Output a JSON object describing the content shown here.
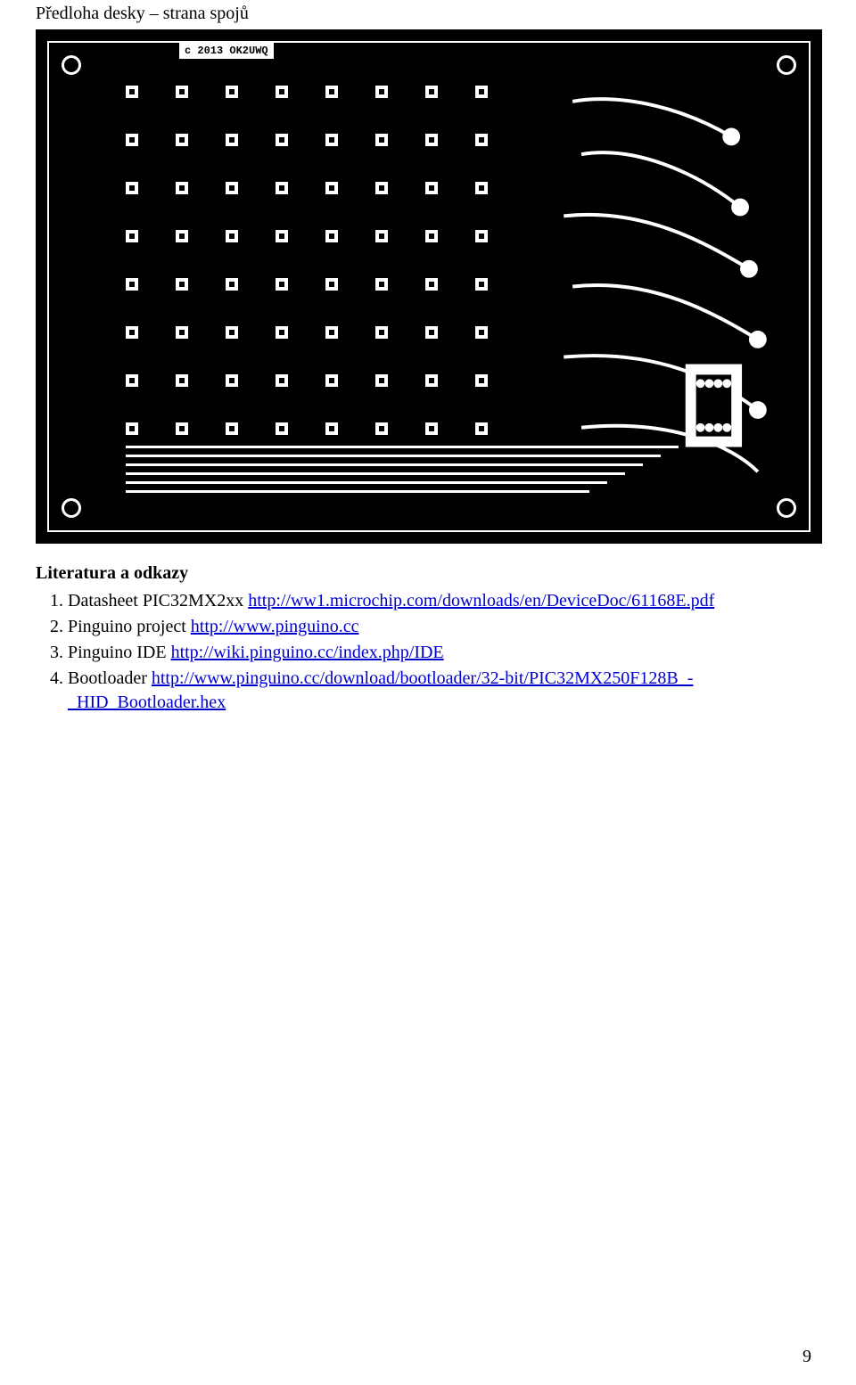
{
  "title_pcb": "Předloha desky – strana spojů",
  "pcb_label": "c 2013 OK2UWQ",
  "lit_heading": "Literatura a odkazy",
  "refs": [
    {
      "prefix": "Datasheet PIC32MX2xx ",
      "link": "http://ww1.microchip.com/downloads/en/DeviceDoc/61168E.pdf"
    },
    {
      "prefix": "Pinguino project ",
      "link": "http://www.pinguino.cc"
    },
    {
      "prefix": "Pinguino IDE ",
      "link": "http://wiki.pinguino.cc/index.php/IDE"
    },
    {
      "prefix": "Bootloader ",
      "link": "http://www.pinguino.cc/download/bootloader/32-bit/PIC32MX250F128B_-_HID_Bootloader.hex"
    }
  ],
  "page_number": "9"
}
